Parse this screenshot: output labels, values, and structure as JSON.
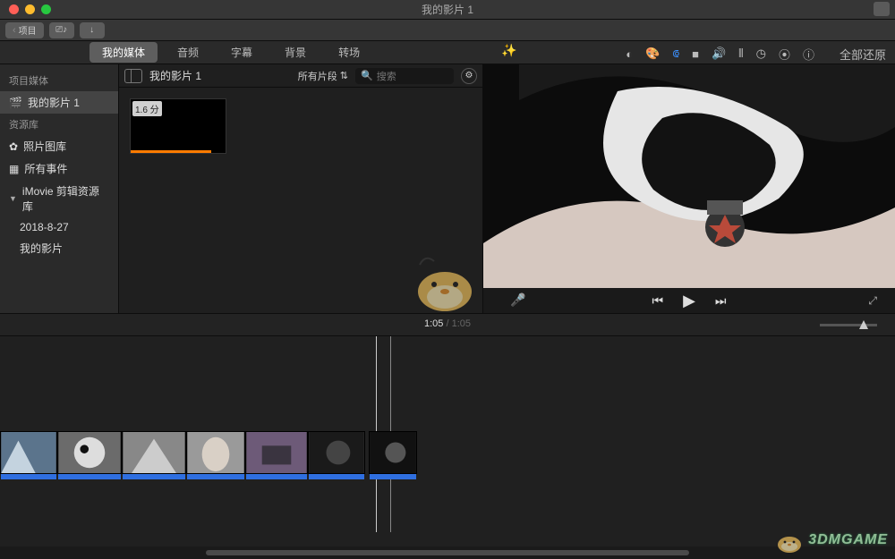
{
  "window": {
    "title": "我的影片 1"
  },
  "toolbar": {
    "back_label": "项目",
    "btn2": "⎚♪",
    "btn3": "↓"
  },
  "tabs": [
    "我的媒体",
    "音频",
    "字幕",
    "背景",
    "转场"
  ],
  "tabs_active": 0,
  "preview_tools": {
    "reset_all": "全部还原"
  },
  "sidebar": {
    "project_media_head": "项目媒体",
    "project_name": "我的影片 1",
    "library_head": "资源库",
    "photo_lib": "照片图库",
    "all_events": "所有事件",
    "imovie_lib": "iMovie 剪辑资源库",
    "event_date": "2018-8-27",
    "my_movie": "我的影片"
  },
  "browser": {
    "title": "我的影片 1",
    "filter_label": "所有片段",
    "search_placeholder": "搜索",
    "clip_duration": "1.6 分"
  },
  "playback": {
    "current": "1:05",
    "total": "1:05"
  },
  "watermark": "3DMGAME"
}
